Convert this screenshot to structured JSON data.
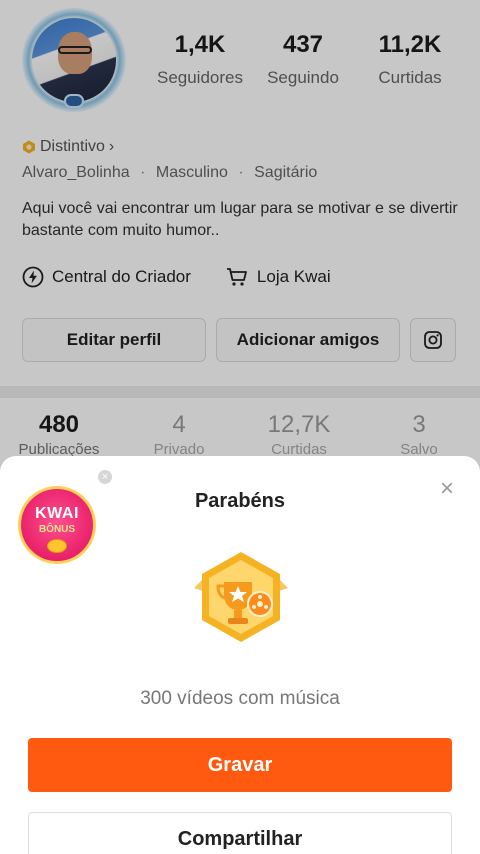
{
  "profile": {
    "stats": [
      {
        "value": "1,4K",
        "label": "Seguidores"
      },
      {
        "value": "437",
        "label": "Seguindo"
      },
      {
        "value": "11,2K",
        "label": "Curtidas"
      }
    ],
    "distintivo_label": "Distintivo",
    "distintivo_chevron": "›",
    "username": "Alvaro_Bolinha",
    "gender": "Masculino",
    "sign": "Sagitário",
    "info_separator": "·",
    "bio": "Aqui você vai encontrar um lugar para se motivar e se divertir bastante com muito humor..",
    "links": {
      "creator_center": "Central do Criador",
      "kwai_shop": "Loja Kwai"
    },
    "buttons": {
      "edit_profile": "Editar perfil",
      "add_friends": "Adicionar amigos"
    },
    "tabs": [
      {
        "value": "480",
        "label": "Publicações"
      },
      {
        "value": "4",
        "label": "Privado"
      },
      {
        "value": "12,7K",
        "label": "Curtidas"
      },
      {
        "value": "3",
        "label": "Salvo"
      }
    ]
  },
  "sheet": {
    "title": "Parabéns",
    "close_glyph": "×",
    "bonus_badge": {
      "line1": "KWAI",
      "line2": "BÔNUS",
      "close_glyph": "×"
    },
    "achievement_caption": "300 vídeos com música",
    "primary_button": "Gravar",
    "secondary_button": "Compartilhar"
  },
  "colors": {
    "accent_orange": "#ff5a0f",
    "medal_gold": "#f5b323",
    "bonus_pink": "#e8216a"
  },
  "icons": {
    "creator_center": "lightning-circle-icon",
    "kwai_shop": "cart-icon",
    "instagram": "instagram-icon",
    "achievement": "trophy-medal-icon",
    "close": "close-icon"
  }
}
